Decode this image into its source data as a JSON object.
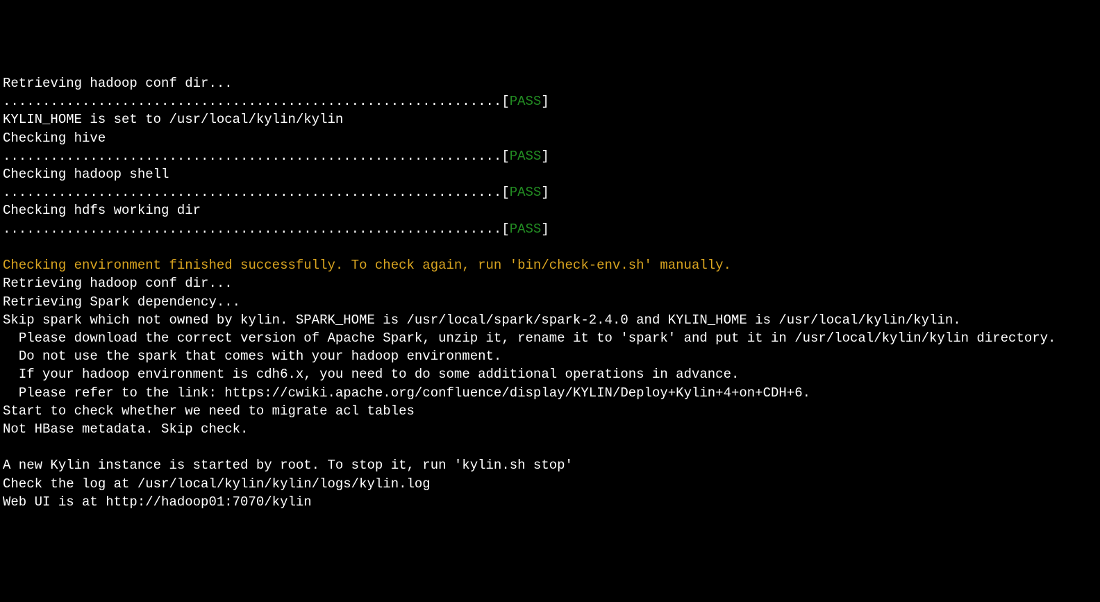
{
  "lines": {
    "l1": "Retrieving hadoop conf dir...",
    "dots": "...............................................................[",
    "pass": "PASS",
    "bracket_close": "]",
    "l3": "KYLIN_HOME is set to /usr/local/kylin/kylin",
    "l4": "Checking hive",
    "l6": "Checking hadoop shell",
    "l8": "Checking hdfs working dir",
    "blank": "",
    "success": "Checking environment finished successfully. To check again, run 'bin/check-env.sh' manually.",
    "l11": "Retrieving hadoop conf dir...",
    "l12": "Retrieving Spark dependency...",
    "l13": "Skip spark which not owned by kylin. SPARK_HOME is /usr/local/spark/spark-2.4.0 and KYLIN_HOME is /usr/local/kylin/kylin.",
    "l14": "  Please download the correct version of Apache Spark, unzip it, rename it to 'spark' and put it in /usr/local/kylin/kylin directory.",
    "l15": "  Do not use the spark that comes with your hadoop environment.",
    "l16": "  If your hadoop environment is cdh6.x, you need to do some additional operations in advance.",
    "l17": "  Please refer to the link: https://cwiki.apache.org/confluence/display/KYLIN/Deploy+Kylin+4+on+CDH+6.",
    "l18": "Start to check whether we need to migrate acl tables",
    "l19": "Not HBase metadata. Skip check.",
    "l21": "A new Kylin instance is started by root. To stop it, run 'kylin.sh stop'",
    "l22": "Check the log at /usr/local/kylin/kylin/logs/kylin.log",
    "l23": "Web UI is at http://hadoop01:7070/kylin"
  }
}
